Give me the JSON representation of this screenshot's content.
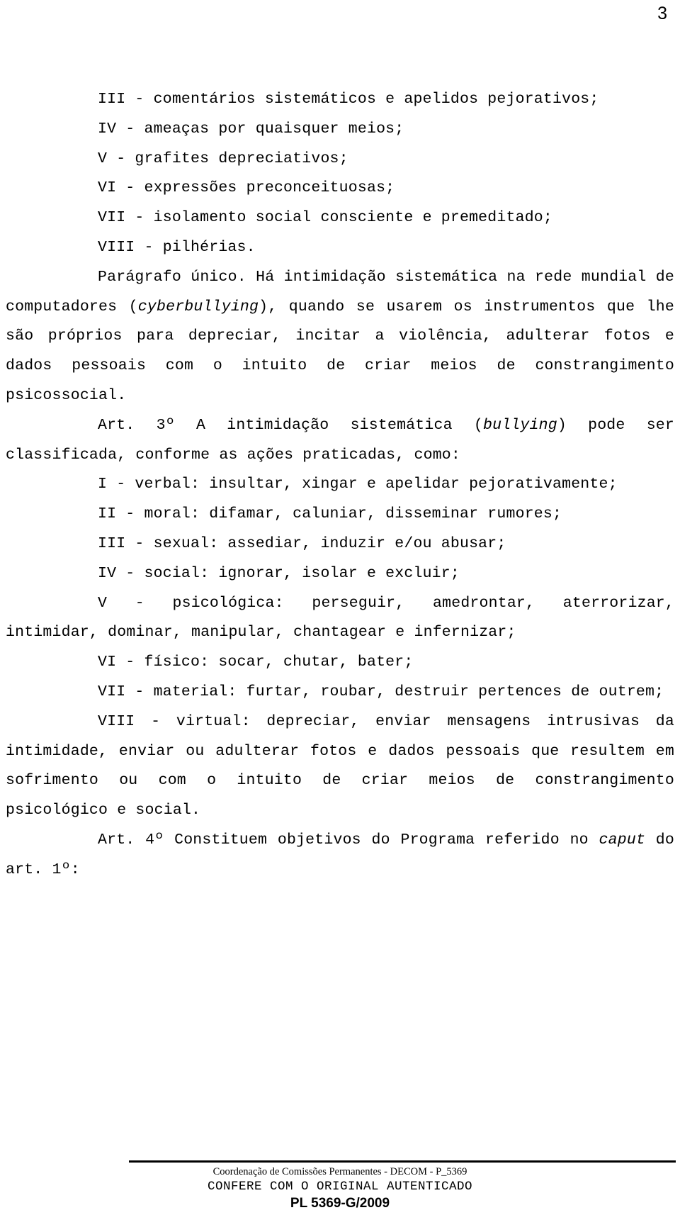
{
  "document": {
    "page_number": "3",
    "language": "pt-BR",
    "paragraphs": [
      {
        "id": "item-iii",
        "indent": true,
        "justify": true,
        "text": "III - comentários sistemáticos e apelidos pejorativos;"
      },
      {
        "id": "item-iv",
        "indent": true,
        "justify": false,
        "text": "IV - ameaças por quaisquer meios;"
      },
      {
        "id": "item-v",
        "indent": true,
        "justify": false,
        "text": "V - grafites depreciativos;"
      },
      {
        "id": "item-vi",
        "indent": true,
        "justify": false,
        "text": "VI - expressões preconceituosas;"
      },
      {
        "id": "item-vii",
        "indent": true,
        "justify": false,
        "text": "VII - isolamento social consciente e premeditado;"
      },
      {
        "id": "item-viii",
        "indent": true,
        "justify": false,
        "text": "VIII - pilhérias."
      },
      {
        "id": "paragrafo-unico",
        "indent": true,
        "justify": true,
        "html": "Parágrafo único. Há intimidação sistemática na rede mundial de computadores (<i>cyberbullying</i>), quando se usarem os instrumentos que lhe são próprios para depreciar, incitar a violência, adulterar fotos e dados pessoais com o intuito de criar meios de constrangimento psicossocial.",
        "text": "Parágrafo único. Há intimidação sistemática na rede mundial de computadores (cyberbullying), quando se usarem os instrumentos que lhe são próprios para depreciar, incitar a violência, adulterar fotos e dados pessoais com o intuito de criar meios de constrangimento psicossocial."
      },
      {
        "id": "art-3",
        "indent": true,
        "justify": true,
        "html": "Art. 3º A intimidação sistemática (<i>bullying</i>) pode ser classificada, conforme as ações praticadas, como:",
        "text": "Art. 3º A intimidação sistemática (bullying) pode ser classificada, conforme as ações praticadas, como:"
      },
      {
        "id": "art3-item-i",
        "indent": true,
        "justify": true,
        "text": "I - verbal: insultar, xingar e apelidar pejorativamente;"
      },
      {
        "id": "art3-item-ii",
        "indent": true,
        "justify": true,
        "text": "II - moral: difamar, caluniar, disseminar rumores;"
      },
      {
        "id": "art3-item-iii",
        "indent": true,
        "justify": false,
        "text": "III - sexual: assediar, induzir e/ou abusar;"
      },
      {
        "id": "art3-item-iv",
        "indent": true,
        "justify": false,
        "text": "IV - social: ignorar, isolar e excluir;"
      },
      {
        "id": "art3-item-v",
        "indent": true,
        "justify": true,
        "text": "V - psicológica: perseguir, amedrontar, aterrorizar, intimidar, dominar, manipular, chantagear e infernizar;"
      },
      {
        "id": "art3-item-vi",
        "indent": true,
        "justify": false,
        "text": "VI - físico: socar, chutar, bater;"
      },
      {
        "id": "art3-item-vii",
        "indent": true,
        "justify": true,
        "text": "VII - material: furtar, roubar, destruir pertences de outrem;"
      },
      {
        "id": "art3-item-viii",
        "indent": true,
        "justify": true,
        "text": "VIII - virtual: depreciar, enviar mensagens intrusivas da intimidade, enviar ou adulterar fotos e dados pessoais que resultem em sofrimento ou com o intuito de criar meios de constrangimento psicológico e social."
      },
      {
        "id": "art-4",
        "indent": true,
        "justify": true,
        "html": "Art. 4º Constituem objetivos do Programa referido no <i>caput</i> do art. 1º:",
        "text": "Art. 4º Constituem objetivos do Programa referido no caput do art. 1º:"
      }
    ]
  },
  "footer": {
    "line1": "Coordenação de Comissões Permanentes - DECOM - P_5369",
    "line2": "CONFERE COM O ORIGINAL AUTENTICADO",
    "line3": "PL 5369-G/2009"
  },
  "colors": {
    "text": "#000000",
    "background": "#ffffff",
    "rule": "#000000"
  }
}
